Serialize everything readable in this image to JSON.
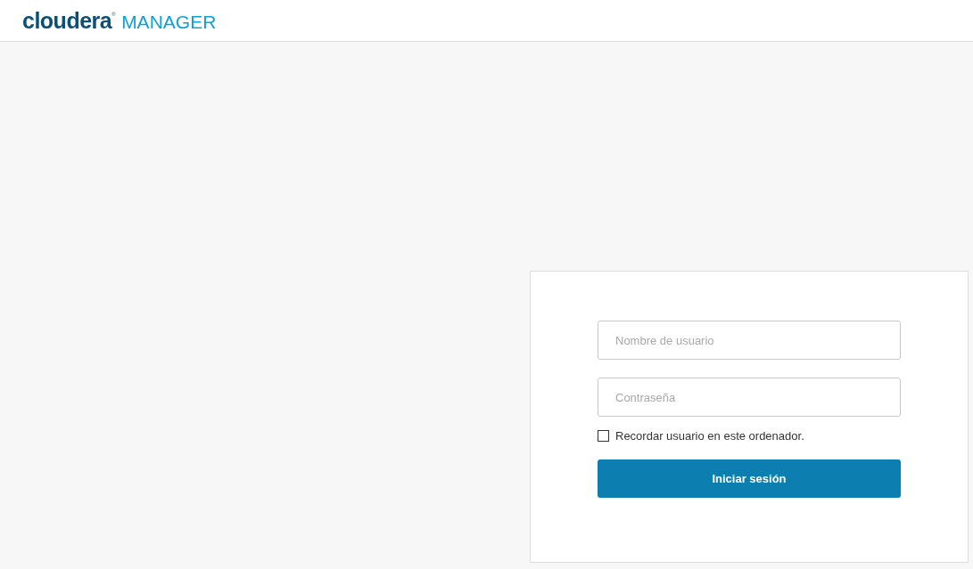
{
  "header": {
    "logo": "cloudera$^{®}$",
    "product": "MANAGER"
  },
  "login": {
    "username": {
      "placeholder": "Nombre de usuario"
    },
    "password": {
      "placeholder": "Contraseña"
    },
    "remember": {
      "label": "Recordar usuario en este ordenador.",
      "checked": false
    },
    "submit": "Iniciar sesión"
  }
}
